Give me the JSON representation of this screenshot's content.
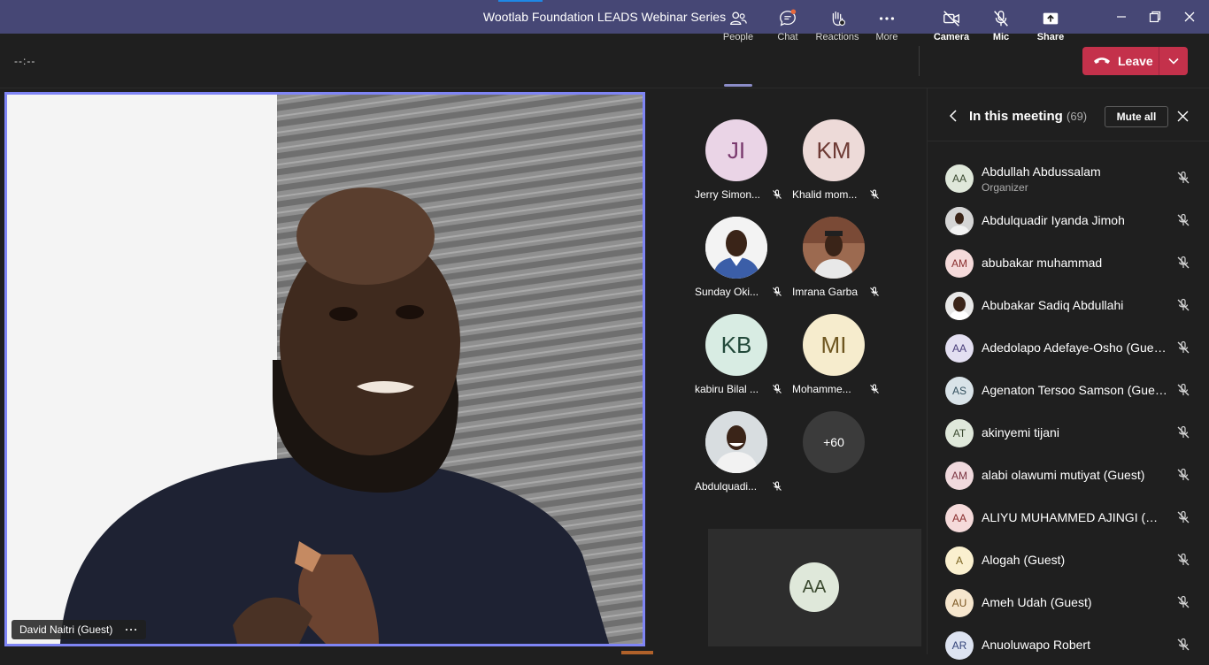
{
  "window": {
    "title": "Wootlab Foundation LEADS Webinar Series"
  },
  "toolbar": {
    "timer": "--:--",
    "people": "People",
    "chat": "Chat",
    "reactions": "Reactions",
    "more": "More",
    "camera": "Camera",
    "mic": "Mic",
    "share": "Share",
    "leave": "Leave"
  },
  "stage": {
    "name": "David Naitri (Guest)",
    "more": "···"
  },
  "gallery": {
    "tiles": [
      {
        "initials": "JI",
        "name": "Jerry Simon...",
        "bg": "#ead4e6",
        "fg": "#7a3a6e"
      },
      {
        "initials": "KM",
        "name": "Khalid mom...",
        "bg": "#eddad8",
        "fg": "#6e3a34"
      },
      {
        "initials": "",
        "name": "Sunday Oki...",
        "bg": "#f3f3f3",
        "fg": "#333333"
      },
      {
        "initials": "",
        "name": "Imrana Garba",
        "bg": "#8c5a44",
        "fg": "#ffffff"
      },
      {
        "initials": "KB",
        "name": "kabiru Bilal ...",
        "bg": "#d8ece3",
        "fg": "#22493a"
      },
      {
        "initials": "MI",
        "name": "Mohamme...",
        "bg": "#f6eccd",
        "fg": "#6e5620"
      },
      {
        "initials": "",
        "name": "Abdulquadi...",
        "bg": "#d8dde0",
        "fg": "#333333"
      }
    ],
    "more": "+60",
    "self_initials": "AA"
  },
  "panel": {
    "title": "In this meeting",
    "count": "(69)",
    "mute_all": "Mute all",
    "participants": [
      {
        "initials": "AA",
        "name": "Abdullah Abdussalam",
        "role": "Organizer",
        "bg": "#dfe8da",
        "fg": "#3b4a30"
      },
      {
        "initials": "",
        "name": "Abdulquadir Iyanda Jimoh",
        "role": "",
        "bg": "#c9c9c9",
        "fg": "#333333"
      },
      {
        "initials": "AM",
        "name": "abubakar muhammad",
        "role": "",
        "bg": "#f5dada",
        "fg": "#8a2e2e"
      },
      {
        "initials": "",
        "name": "Abubakar Sadiq Abdullahi",
        "role": "",
        "bg": "#7a5a45",
        "fg": "#ffffff"
      },
      {
        "initials": "AA",
        "name": "Adedolapo Adefaye-Osho (Guest)",
        "role": "",
        "bg": "#e3dff1",
        "fg": "#4a3e7a"
      },
      {
        "initials": "AS",
        "name": "Agenaton Tersoo Samson (Guest)",
        "role": "",
        "bg": "#d9e3e8",
        "fg": "#33505e"
      },
      {
        "initials": "AT",
        "name": "akinyemi tijani",
        "role": "",
        "bg": "#dfe8da",
        "fg": "#3b4a30"
      },
      {
        "initials": "AM",
        "name": "alabi olawumi mutiyat (Guest)",
        "role": "",
        "bg": "#f0d9dd",
        "fg": "#7a3340"
      },
      {
        "initials": "AA",
        "name": "ALIYU MUHAMMED AJINGI (Gu...",
        "role": "",
        "bg": "#f5dada",
        "fg": "#8a2e2e"
      },
      {
        "initials": "A",
        "name": "Alogah (Guest)",
        "role": "",
        "bg": "#faf0cf",
        "fg": "#7a6420"
      },
      {
        "initials": "AU",
        "name": "Ameh Udah (Guest)",
        "role": "",
        "bg": "#f6e6cd",
        "fg": "#7a5520"
      },
      {
        "initials": "AR",
        "name": "Anuoluwapo Robert",
        "role": "",
        "bg": "#dde3f1",
        "fg": "#34447a"
      }
    ]
  },
  "colors": {
    "accent": "#7f85f5",
    "titlebar": "#464775",
    "leave": "#c4314b",
    "background": "#1f1f1f"
  }
}
